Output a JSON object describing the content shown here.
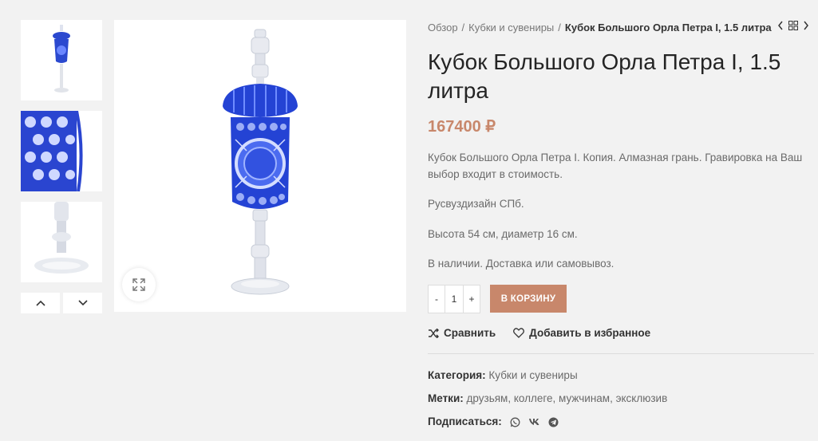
{
  "thumbnails": [
    "thumbnail-full-goblet",
    "thumbnail-cut-detail",
    "thumbnail-stem-detail"
  ],
  "breadcrumb": {
    "items": [
      "Обзор",
      "Кубки и сувениры"
    ],
    "current": "Кубок Большого Орла Петра I, 1.5 литра"
  },
  "product": {
    "title": "Кубок Большого Орла Петра I, 1.5 литра",
    "price": "167400 ₽",
    "description": [
      "Кубок Большого Орла Петра I. Копия. Алмазная грань. Гравировка на Ваш выбор входит в стоимость.",
      "Русвуздизайн СПб.",
      "Высота 54 см, диаметр 16 см.",
      "В наличии. Доставка или самовывоз."
    ]
  },
  "cart": {
    "minus": "-",
    "quantity": "1",
    "plus": "+",
    "add_label": "В КОРЗИНУ"
  },
  "actions": {
    "compare": "Сравнить",
    "wishlist": "Добавить в избранное"
  },
  "meta": {
    "category_label": "Категория:",
    "category": "Кубки и сувениры",
    "tags_label": "Метки:",
    "tags": [
      "друзьям",
      "коллеге",
      "мужчинам",
      "эксклюзив"
    ],
    "share_label": "Подписаться:"
  },
  "icons": [
    "whatsapp-icon",
    "vk-icon",
    "telegram-icon"
  ],
  "colors": {
    "accent": "#c8876b",
    "glass_blue": "#1f3fc4"
  }
}
